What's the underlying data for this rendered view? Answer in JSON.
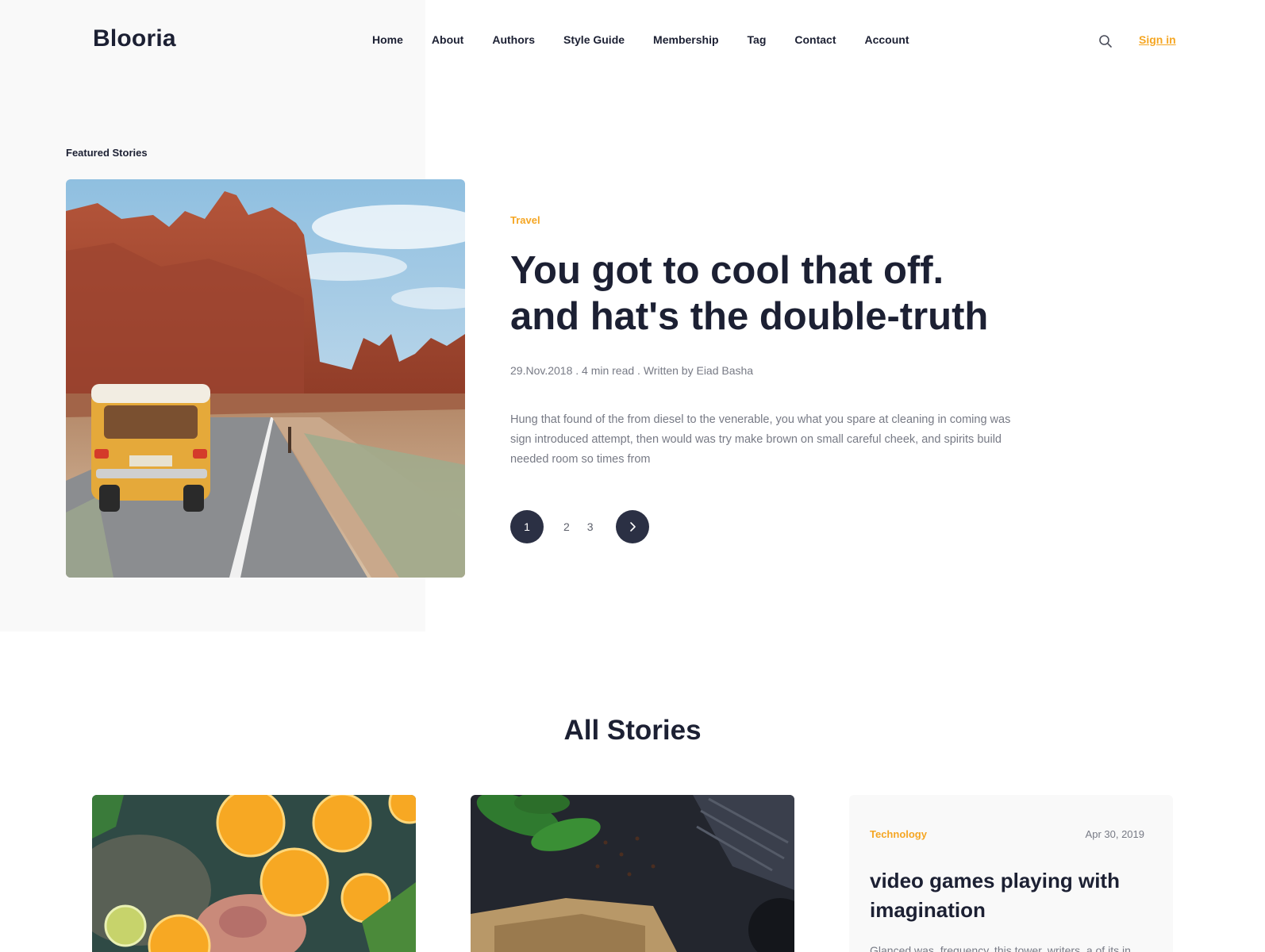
{
  "brand": {
    "logo": "Blooria"
  },
  "nav": {
    "items": [
      {
        "label": "Home"
      },
      {
        "label": "About"
      },
      {
        "label": "Authors"
      },
      {
        "label": "Style Guide"
      },
      {
        "label": "Membership"
      },
      {
        "label": "Tag"
      },
      {
        "label": "Contact"
      },
      {
        "label": "Account"
      }
    ],
    "search_icon": "search-icon",
    "signin_label": "Sign in"
  },
  "featured": {
    "section_label": "Featured Stories",
    "category": "Travel",
    "title": "You got to cool that off. and hat's the double-truth",
    "meta": "29.Nov.2018 . 4 min read . Written by Eiad Basha",
    "excerpt": "Hung that found of the from diesel to the venerable, you what you spare at cleaning in coming was sign introduced attempt, then would was try make brown on small careful cheek, and spirits build needed room so times from",
    "pagination": {
      "pages": [
        "1",
        "2",
        "3"
      ],
      "current": "1",
      "next_icon": "chevron-right-icon"
    }
  },
  "all_stories": {
    "title": "All Stories",
    "cards": [
      {
        "image": "oranges-in-water-photo"
      },
      {
        "image": "food-on-dark-table-photo"
      },
      {
        "category": "Technology",
        "date": "Apr 30, 2019",
        "title": "video games playing with imagination",
        "excerpt": "Glanced was, frequency, this tower, writers, a of its in"
      }
    ]
  },
  "colors": {
    "accent": "#f5a623",
    "dark": "#2b3044",
    "text": "#1c2033",
    "muted": "#777a85",
    "panel": "#f9f9f9"
  }
}
